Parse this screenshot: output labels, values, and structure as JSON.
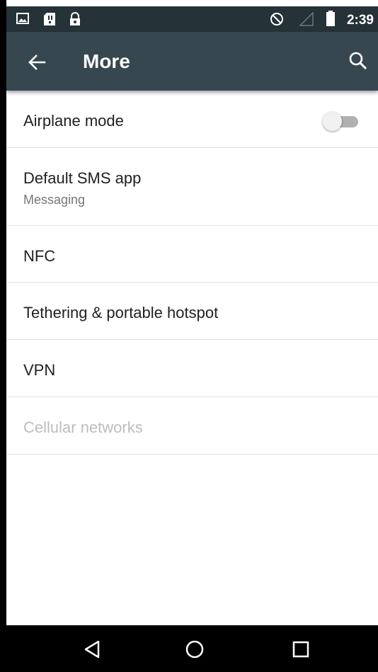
{
  "status_bar": {
    "time": "2:39",
    "icons": [
      "image-icon",
      "sd-card-icon",
      "lock-icon",
      "do-not-disturb-icon",
      "signal-icon",
      "battery-icon"
    ]
  },
  "app_bar": {
    "title": "More",
    "back_icon": "arrow-back-icon",
    "search_icon": "search-icon",
    "background": "#37474f",
    "status_background": "#253238"
  },
  "settings": [
    {
      "id": "airplane",
      "label": "Airplane mode",
      "toggle": false
    },
    {
      "id": "sms",
      "label": "Default SMS app",
      "summary": "Messaging"
    },
    {
      "id": "nfc",
      "label": "NFC"
    },
    {
      "id": "tethering",
      "label": "Tethering & portable hotspot"
    },
    {
      "id": "vpn",
      "label": "VPN"
    },
    {
      "id": "cellular",
      "label": "Cellular networks",
      "disabled": true
    }
  ],
  "nav_bar": {
    "icons": [
      "back-triangle-icon",
      "home-circle-icon",
      "recents-square-icon"
    ]
  }
}
